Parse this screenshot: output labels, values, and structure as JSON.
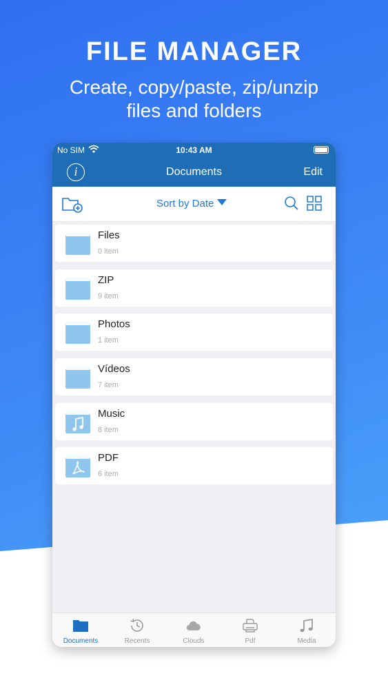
{
  "promo": {
    "title": "FILE MANAGER",
    "subtitle_line1": "Create, copy/paste, zip/unzip",
    "subtitle_line2": "files and folders"
  },
  "status_bar": {
    "carrier": "No SIM",
    "time": "10:43 AM"
  },
  "nav": {
    "info_label": "i",
    "title": "Documents",
    "edit_label": "Edit"
  },
  "toolbar": {
    "sort_label": "Sort by Date"
  },
  "folders": [
    {
      "name": "Files",
      "count": "0 item",
      "icon": "folder-icon"
    },
    {
      "name": "ZIP",
      "count": "9 item",
      "icon": "folder-icon"
    },
    {
      "name": "Photos",
      "count": "1 item",
      "icon": "folder-icon"
    },
    {
      "name": "Vídeos",
      "count": "7 item",
      "icon": "folder-icon"
    },
    {
      "name": "Music",
      "count": "8 item",
      "icon": "music-folder-icon"
    },
    {
      "name": "PDF",
      "count": "6 item",
      "icon": "pdf-folder-icon"
    }
  ],
  "tabs": [
    {
      "label": "Documents",
      "icon": "documents-folder-icon",
      "active": true
    },
    {
      "label": "Recents",
      "icon": "history-icon",
      "active": false
    },
    {
      "label": "Clouds",
      "icon": "cloud-icon",
      "active": false
    },
    {
      "label": "Pdf",
      "icon": "printer-icon",
      "active": false
    },
    {
      "label": "Media",
      "icon": "music-note-icon",
      "active": false
    }
  ],
  "colors": {
    "accent": "#1e78d6",
    "nav_bar": "#1f6db4",
    "folder": "#8fc6ee",
    "background_blue": "#3f8cf6"
  }
}
